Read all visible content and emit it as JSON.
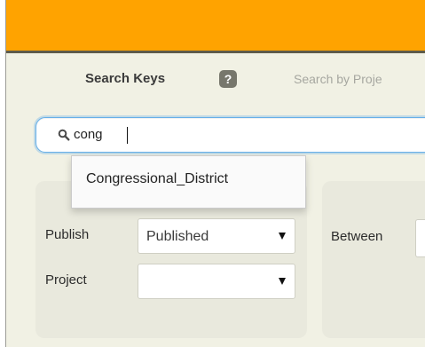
{
  "header": {
    "search_keys_label": "Search Keys",
    "help_badge": "?",
    "search_by_text": "Search by Proje"
  },
  "search": {
    "value": "cong",
    "icon": "search-icon"
  },
  "autocomplete": {
    "options": [
      "Congressional_District"
    ]
  },
  "filters": {
    "publish_label": "Publish",
    "publish_value": "Published",
    "project_label": "Project",
    "project_value": "",
    "between_label": "Between"
  },
  "colors": {
    "topbar": "#ffa300",
    "background": "#f1f1e4",
    "focus": "#66afe9"
  }
}
